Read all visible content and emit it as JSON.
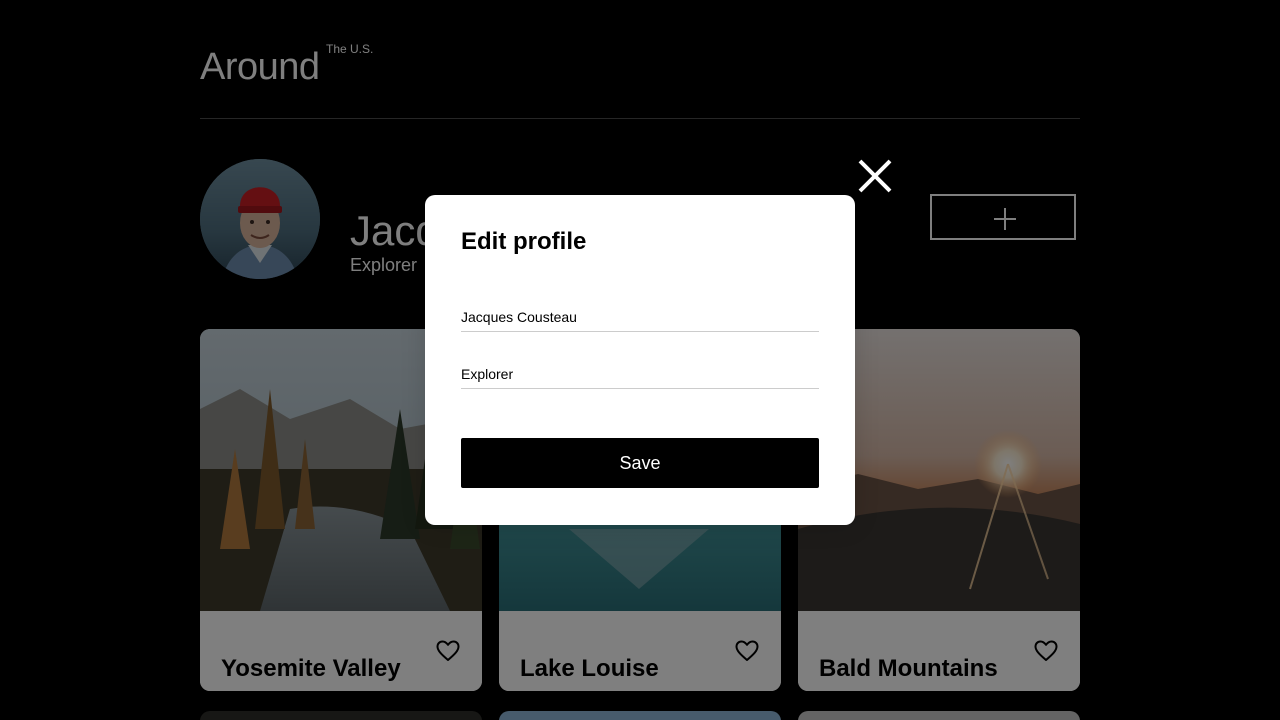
{
  "header": {
    "logo_main": "Around",
    "logo_sup": "The U.S."
  },
  "profile": {
    "name": "Jacques Cousteau",
    "about": "Explorer"
  },
  "cards": [
    {
      "title": "Yosemite Valley",
      "icon": "heart-outline-icon"
    },
    {
      "title": "Lake Louise",
      "icon": "heart-outline-icon"
    },
    {
      "title": "Bald Mountains",
      "icon": "heart-outline-icon"
    }
  ],
  "modal": {
    "title": "Edit profile",
    "name_value": "Jacques Cousteau",
    "about_value": "Explorer",
    "save_label": "Save",
    "close_icon": "close-icon"
  },
  "colors": {
    "background": "#000000",
    "overlay": "rgba(0,0,0,0.5)",
    "modal_bg": "#ffffff",
    "button_bg": "#000000"
  }
}
